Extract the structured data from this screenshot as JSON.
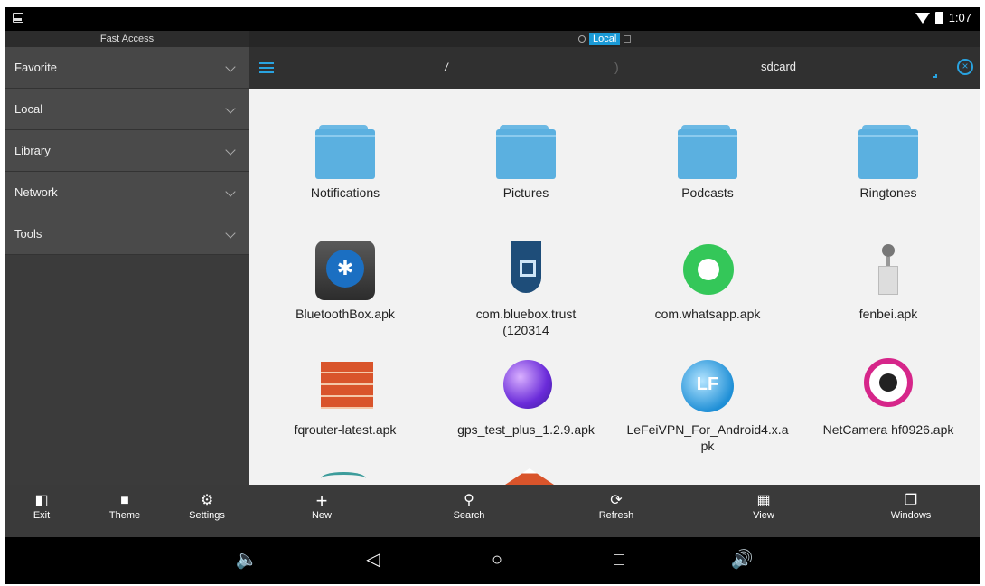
{
  "status_bar": {
    "time": "1:07"
  },
  "sidebar": {
    "header": "Fast Access",
    "items": [
      {
        "label": "Favorite"
      },
      {
        "label": "Local"
      },
      {
        "label": "Library"
      },
      {
        "label": "Network"
      },
      {
        "label": "Tools"
      }
    ]
  },
  "tab": {
    "label": "Local"
  },
  "path": {
    "root": "/",
    "separator": ")",
    "current": "sdcard"
  },
  "files": [
    {
      "name": "Notifications",
      "icon": "folder-icon"
    },
    {
      "name": "Pictures",
      "icon": "folder-icon"
    },
    {
      "name": "Podcasts",
      "icon": "folder-icon"
    },
    {
      "name": "Ringtones",
      "icon": "folder-icon"
    },
    {
      "name": "BluetoothBox.apk",
      "icon": "bluetooth-app-icon"
    },
    {
      "name": "com.bluebox.trust (120314",
      "icon": "bluebox-shield-icon"
    },
    {
      "name": "com.whatsapp.apk",
      "icon": "whatsapp-icon"
    },
    {
      "name": "fenbei.apk",
      "icon": "sound-meter-icon"
    },
    {
      "name": "fqrouter-latest.apk",
      "icon": "brick-wall-icon"
    },
    {
      "name": "gps_test_plus_1.2.9.apk",
      "icon": "globe-icon"
    },
    {
      "name": "LeFeiVPN_For_Android4.x.apk",
      "icon": "lefei-vpn-icon"
    },
    {
      "name": "NetCamera hf0926.apk",
      "icon": "camera-lens-icon"
    }
  ],
  "toolbar": {
    "exit": "Exit",
    "theme": "Theme",
    "settings": "Settings",
    "new": "New",
    "search": "Search",
    "refresh": "Refresh",
    "view": "View",
    "windows": "Windows"
  }
}
